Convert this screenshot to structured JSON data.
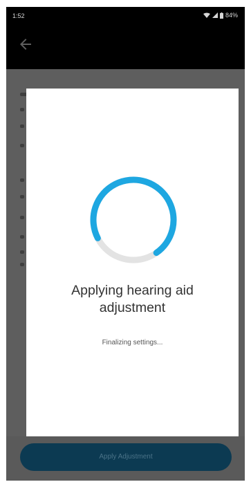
{
  "status_bar": {
    "time": "1:52",
    "battery": "84%"
  },
  "dialog": {
    "title_line1": "Applying hearing aid",
    "title_line2": "adjustment",
    "message": "Finalizing settings..."
  },
  "footer": {
    "apply_label": "Apply Adjustment"
  },
  "colors": {
    "accent": "#1ea7e1",
    "dim_overlay": "#5b5b5b",
    "button": "#0c3a52"
  },
  "icons": {
    "back": "back-arrow-icon",
    "wifi": "wifi-icon",
    "signal": "signal-icon",
    "battery": "battery-icon"
  }
}
